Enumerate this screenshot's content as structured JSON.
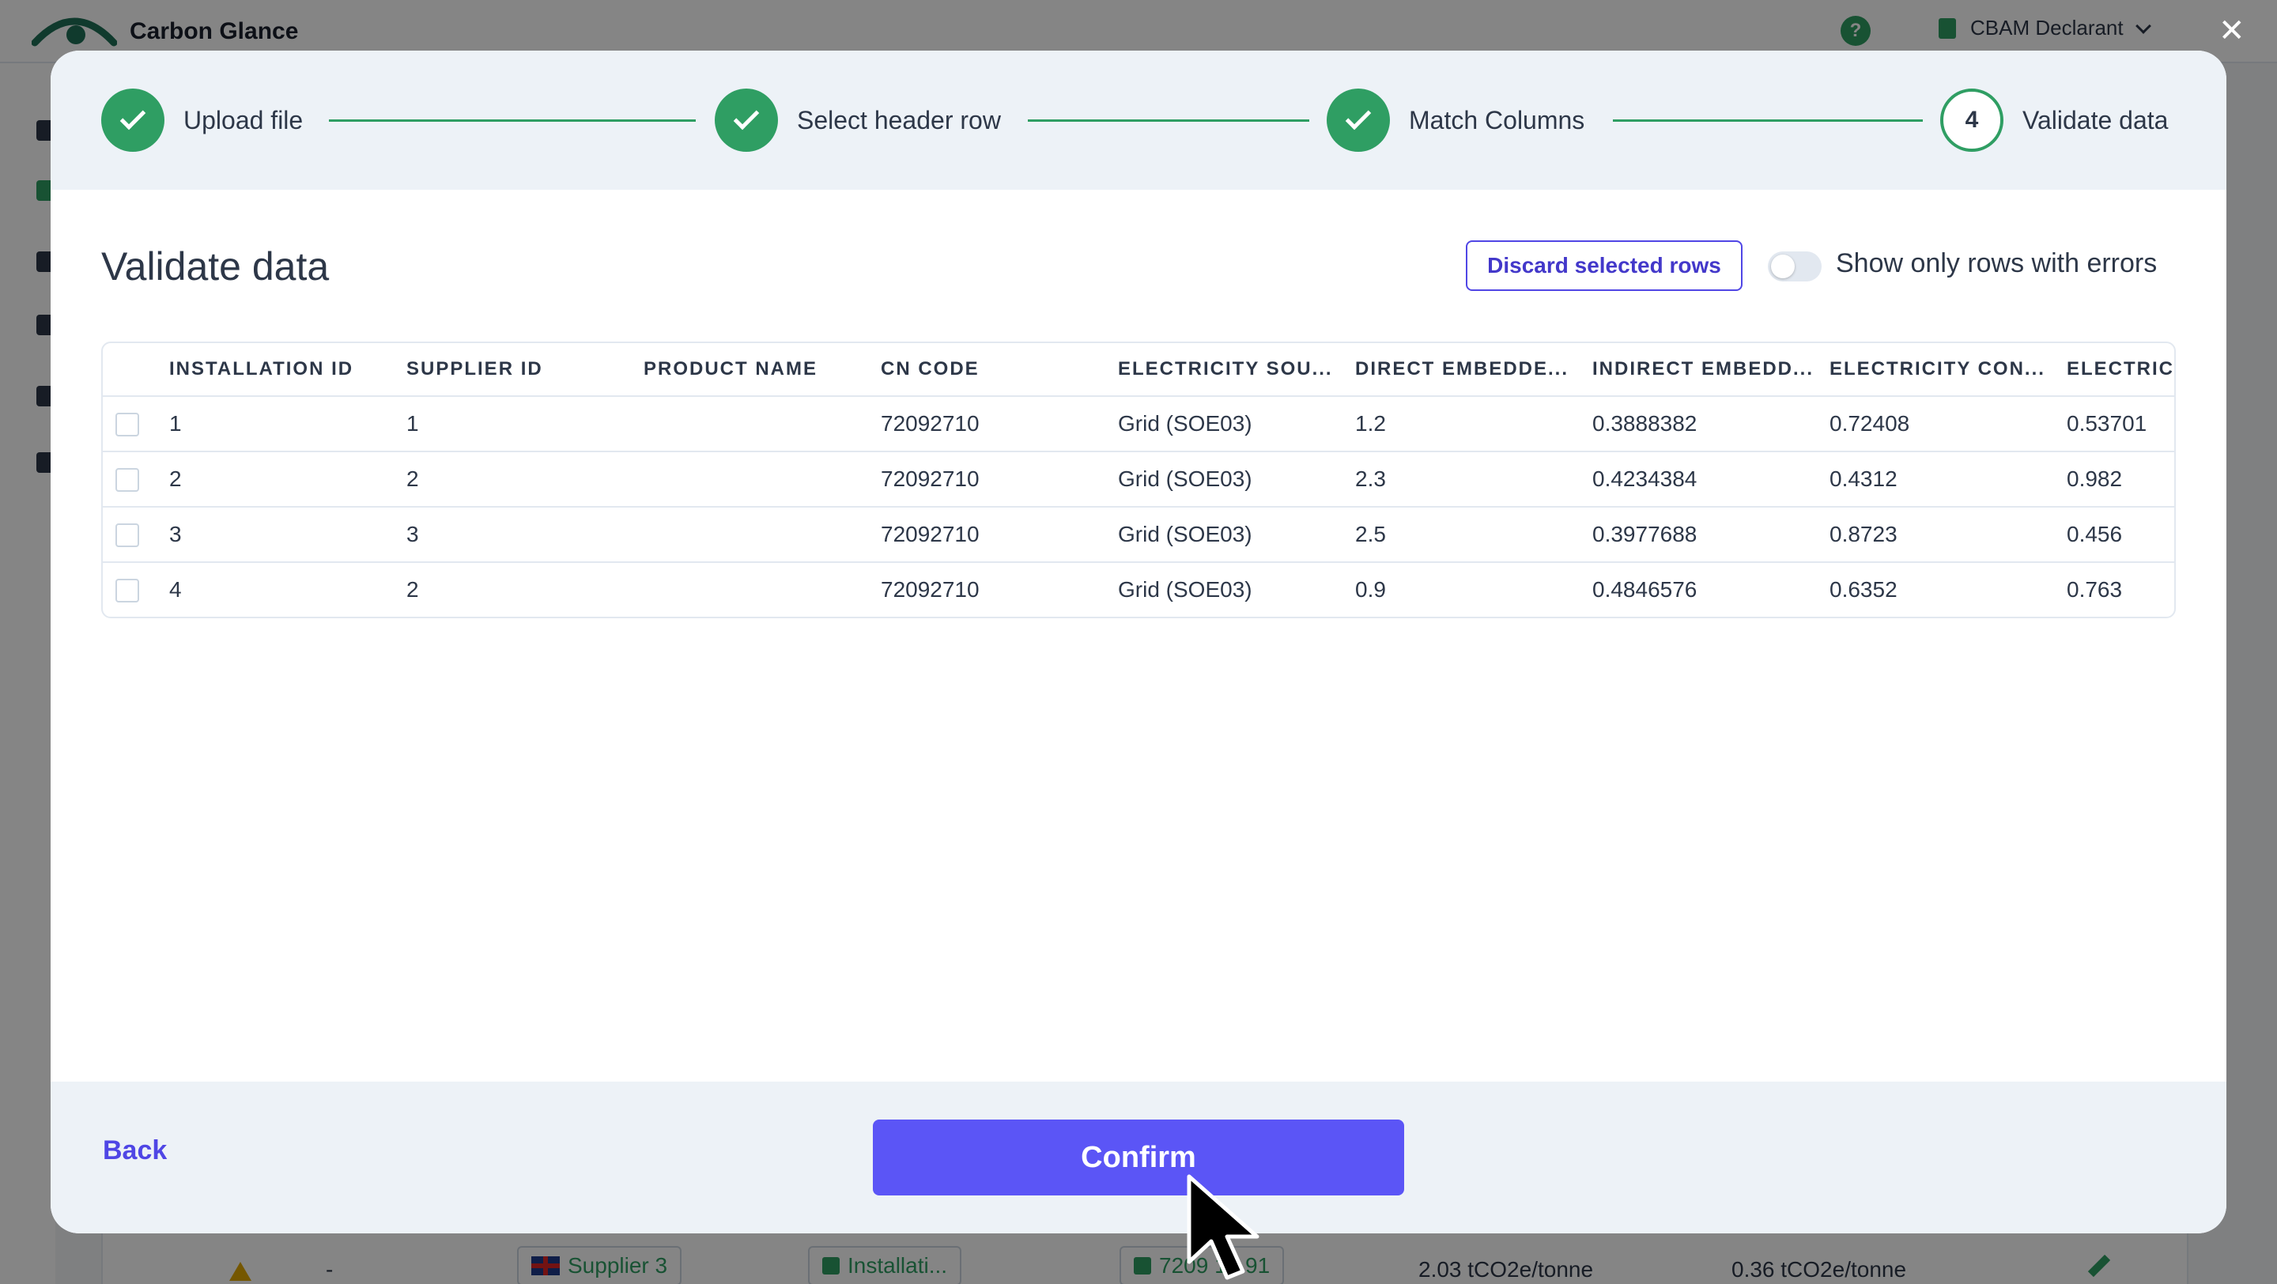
{
  "app": {
    "brand": "Carbon Glance",
    "help_label": "?",
    "account_label": "CBAM Declarant",
    "close_label": "✕"
  },
  "background_row": {
    "warning": "-",
    "supplier": "Supplier 3",
    "installation": "Installati...",
    "cn_code": "7209 16 91",
    "direct": "2.03 tCO2e/tonne",
    "indirect": "0.36 tCO2e/tonne"
  },
  "stepper": {
    "steps": [
      {
        "label": "Upload file",
        "state": "done"
      },
      {
        "label": "Select header row",
        "state": "done"
      },
      {
        "label": "Match Columns",
        "state": "done"
      },
      {
        "label": "Validate data",
        "state": "active",
        "number": "4"
      }
    ]
  },
  "main": {
    "title": "Validate data",
    "discard_label": "Discard selected rows",
    "errors_toggle_label": "Show only rows with errors",
    "errors_toggle_on": false
  },
  "table": {
    "headers": [
      "INSTALLATION ID",
      "SUPPLIER ID",
      "PRODUCT NAME",
      "CN CODE",
      "ELECTRICITY SOU...",
      "DIRECT EMBEDDE...",
      "INDIRECT EMBEDD...",
      "ELECTRICITY CON...",
      "ELECTRICI"
    ],
    "rows": [
      [
        "1",
        "1",
        "",
        "72092710",
        "Grid (SOE03)",
        "1.2",
        "0.3888382",
        "0.72408",
        "0.53701"
      ],
      [
        "2",
        "2",
        "",
        "72092710",
        "Grid (SOE03)",
        "2.3",
        "0.4234384",
        "0.4312",
        "0.982"
      ],
      [
        "3",
        "3",
        "",
        "72092710",
        "Grid (SOE03)",
        "2.5",
        "0.3977688",
        "0.8723",
        "0.456"
      ],
      [
        "4",
        "2",
        "",
        "72092710",
        "Grid (SOE03)",
        "0.9",
        "0.4846576",
        "0.6352",
        "0.763"
      ]
    ]
  },
  "footer": {
    "back_label": "Back",
    "confirm_label": "Confirm"
  },
  "colors": {
    "brand_green": "#2f9e63",
    "primary": "#5b55f6",
    "link": "#4f46e5"
  }
}
